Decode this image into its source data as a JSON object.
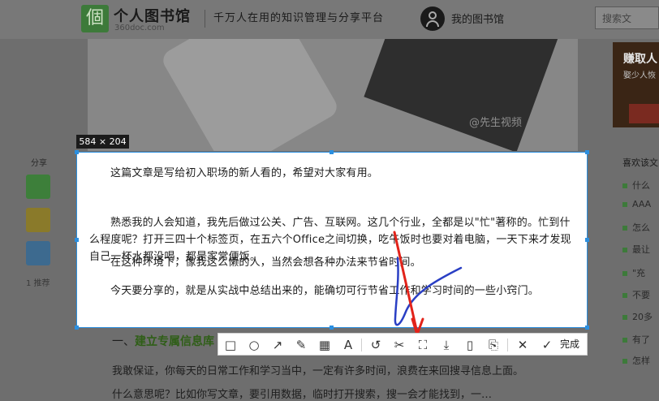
{
  "header": {
    "logo_char": "個",
    "site_title": "个人图书馆",
    "site_domain": "360doc.com",
    "slogan": "千万人在用的知识管理与分享平台",
    "my_library": "我的图书馆",
    "search_placeholder": "搜索文"
  },
  "hero": {
    "watermark": "@先生视频"
  },
  "sidebar_ad": {
    "title": "赚取人",
    "subtitle": "娶少人恢"
  },
  "favorites": {
    "title": "喜欢该文",
    "items": [
      "什么",
      "AAA",
      "怎么",
      "最让",
      "\"充",
      "不要",
      "20多",
      "有了",
      "怎样"
    ]
  },
  "share": {
    "label": "分享",
    "count": "1 推荐"
  },
  "selection": {
    "size_label": "584 × 204",
    "paragraphs": [
      "这篇文章是写给初入职场的新人看的，希望对大家有用。",
      "熟悉我的人会知道，我先后做过公关、广告、互联网。这几个行业，全都是以\"忙\"著称的。忙到什么程度呢？打开三四十个标签页，在五六个Office之间切换，吃午饭时也要对着电脑，一天下来才发现自己一杯水都没喝，都是家常便饭。",
      "在这种环境下，像我这么懒的人，当然会想各种办法来节省时间。",
      "今天要分享的，就是从实战中总结出来的，能确切可行节省工作和学习时间的一些小窍门。"
    ]
  },
  "article": {
    "heading_prefix": "一、",
    "heading_highlight": "建立专属信息库",
    "line1": "我敢保证，你每天的日常工作和学习当中，一定有许多时间，浪费在来回搜寻信息上面。",
    "line2": "什么意思呢？比如你写文章，要引用数据，临时打开搜索，搜一会才能找到，一…"
  },
  "toolbar": {
    "icons": [
      "rect-icon",
      "ellipse-icon",
      "arrow-icon",
      "pen-icon",
      "mosaic-icon",
      "text-icon",
      "undo-icon",
      "cut-icon",
      "ocr-icon",
      "download-icon",
      "pin-icon",
      "bookmark-icon",
      "close-icon",
      "check-icon"
    ],
    "glyphs": [
      "□",
      "○",
      "↗",
      "✎",
      "▦",
      "A",
      "↺",
      "✂",
      "⛶",
      "⤓",
      "▯",
      "⎘",
      "✕",
      "✓"
    ],
    "done_label": "完成"
  },
  "colors": {
    "accent": "#2b8fe0",
    "annotation_red": "#e2231a",
    "annotation_blue": "#2a3fc4",
    "brand_green": "#3d7a3a"
  }
}
